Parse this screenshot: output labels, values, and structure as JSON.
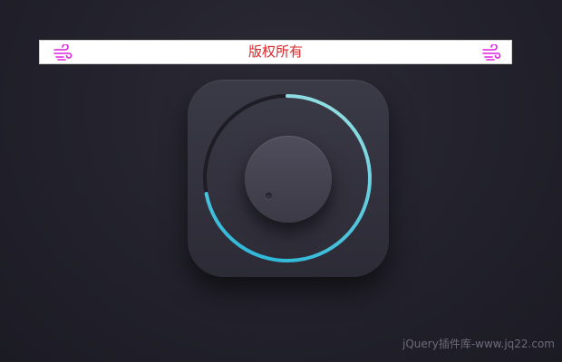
{
  "banner": {
    "text": "版权所有",
    "icon_left": "wind-icon",
    "icon_right": "wind-icon",
    "icon_color": "#e020e0",
    "text_color": "#d6262a"
  },
  "dial": {
    "value": 0.72,
    "accent_start": "#2ab6d8",
    "accent_end": "#8fdde2",
    "track_color": "#1e1d26"
  },
  "watermark": {
    "text": "jQuery插件库-www.jq22.com"
  }
}
